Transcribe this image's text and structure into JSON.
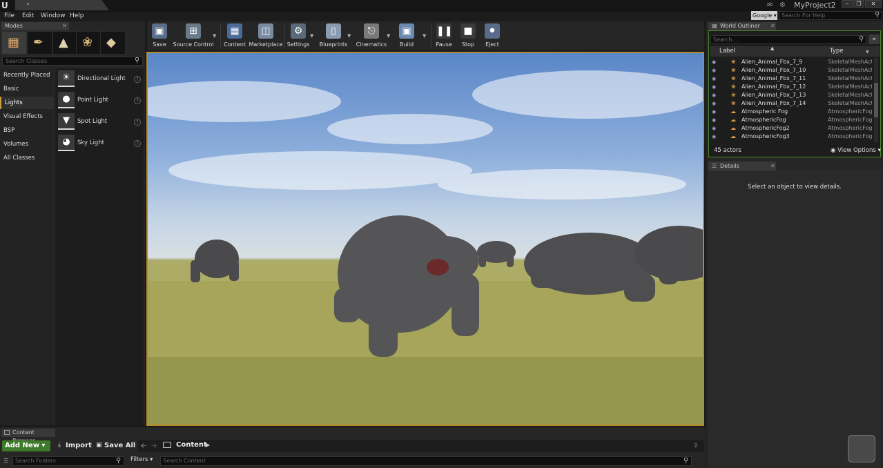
{
  "titlebar": {
    "level_tab": "•",
    "project_name": "MyProject2",
    "minimize": "‒",
    "restore": "❐",
    "close": "✕"
  },
  "menu": {
    "items": [
      "File",
      "Edit",
      "Window",
      "Help"
    ],
    "search_engine": "Google ▾",
    "help_search_placeholder": "Search For Help"
  },
  "modes": {
    "tab_label": "Modes",
    "search_placeholder": "Search Classes",
    "categories": [
      "Recently Placed",
      "Basic",
      "Lights",
      "Visual Effects",
      "BSP",
      "Volumes",
      "All Classes"
    ],
    "active_category": "Lights",
    "place_items": [
      {
        "label": "Directional Light",
        "icon": "directional-light-icon"
      },
      {
        "label": "Point Light",
        "icon": "point-light-icon"
      },
      {
        "label": "Spot Light",
        "icon": "spot-light-icon"
      },
      {
        "label": "Sky Light",
        "icon": "sky-light-icon"
      }
    ]
  },
  "toolbar": {
    "save": "Save",
    "source_control": "Source Control",
    "content": "Content",
    "marketplace": "Marketplace",
    "settings": "Settings",
    "blueprints": "Blueprints",
    "cinematics": "Cinematics",
    "build": "Build",
    "pause": "Pause",
    "stop": "Stop",
    "eject": "Eject"
  },
  "content_browser": {
    "tab_label": "Content Browser",
    "add_new": "Add New ▾",
    "import": "Import",
    "save_all": "Save All",
    "path": "Content",
    "folder_search_placeholder": "Search Folders",
    "filters": "Filters ▾",
    "content_search_placeholder": "Search Content"
  },
  "world_outliner": {
    "tab_label": "World Outliner",
    "search_placeholder": "Search...",
    "col_label": "Label",
    "col_type": "Type",
    "rows": [
      {
        "label": "Alien_Animal_Fbx_7_9",
        "type": "SkeletalMeshActo"
      },
      {
        "label": "Alien_Animal_Fbx_7_10",
        "type": "SkeletalMeshActo"
      },
      {
        "label": "Alien_Animal_Fbx_7_11",
        "type": "SkeletalMeshActo"
      },
      {
        "label": "Alien_Animal_Fbx_7_12",
        "type": "SkeletalMeshActo"
      },
      {
        "label": "Alien_Animal_Fbx_7_13",
        "type": "SkeletalMeshActo"
      },
      {
        "label": "Alien_Animal_Fbx_7_14",
        "type": "SkeletalMeshActo"
      },
      {
        "label": "Atmospheric Fog",
        "type": "AtmosphericFog"
      },
      {
        "label": "AtmosphericFog",
        "type": "AtmosphericFog"
      },
      {
        "label": "AtmosphericFog2",
        "type": "AtmosphericFog"
      },
      {
        "label": "AtmosphericFog3",
        "type": "AtmosphericFog"
      }
    ],
    "actor_count": "45 actors",
    "view_options": "◉ View Options ▾"
  },
  "details": {
    "tab_label": "Details",
    "empty_message": "Select an object to view details."
  },
  "colors": {
    "viewport_border": "#b58a2a",
    "outliner_border": "#4a8a2a",
    "add_new_bg": "#3e7a2a"
  }
}
